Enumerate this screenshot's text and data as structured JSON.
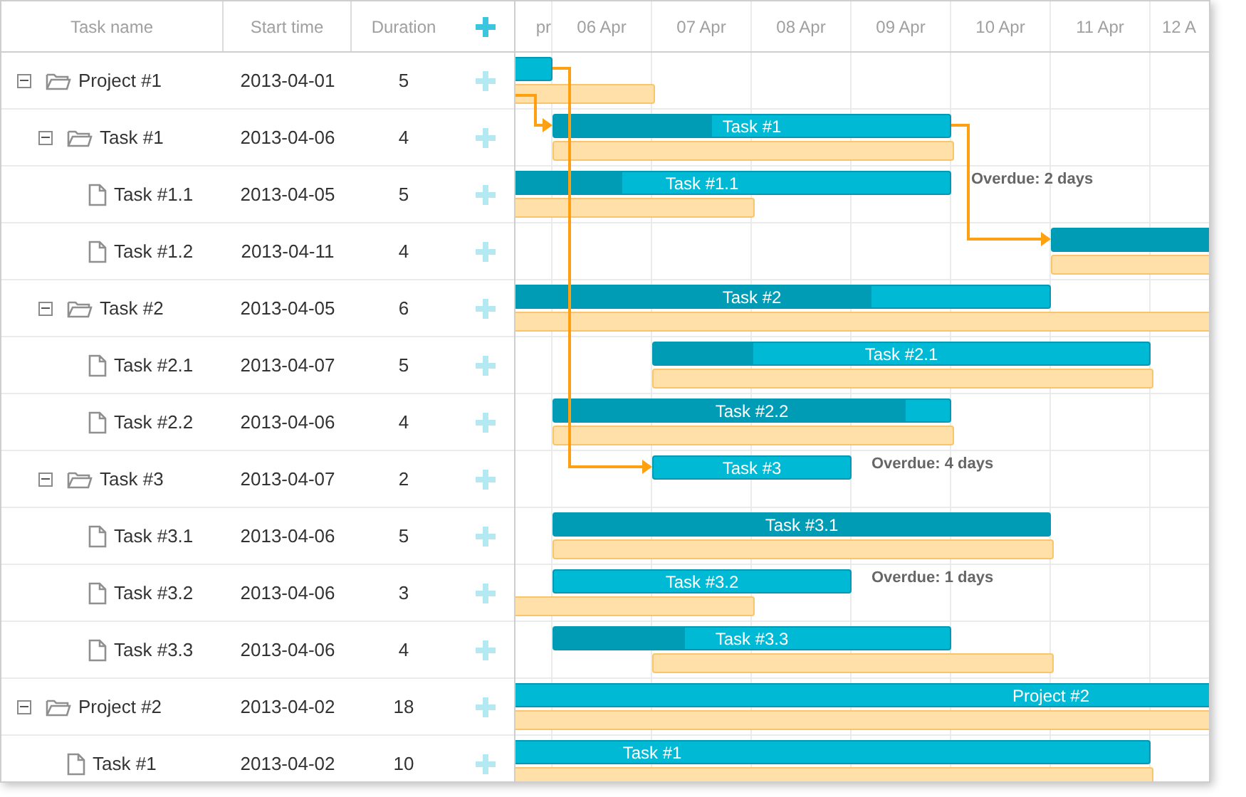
{
  "columns": [
    {
      "label": "Task name"
    },
    {
      "label": "Start time"
    },
    {
      "label": "Duration"
    }
  ],
  "scale": [
    {
      "label": "pr"
    },
    {
      "label": "06 Apr"
    },
    {
      "label": "07 Apr"
    },
    {
      "label": "08 Apr"
    },
    {
      "label": "09 Apr"
    },
    {
      "label": "10 Apr"
    },
    {
      "label": "11 Apr"
    },
    {
      "label": "12 A"
    }
  ],
  "tasks": [
    {
      "name": "Project #1",
      "start": "2013-04-01",
      "duration": "5",
      "expanded": true,
      "children": [
        {
          "name": "Task #1",
          "bar_label": "Task #1",
          "start": "2013-04-06",
          "duration": "4",
          "expanded": true,
          "level": 0.4,
          "children": [
            {
              "name": "Task #1.1",
              "bar_label": "Task #1.1",
              "start": "2013-04-05",
              "duration": "5",
              "level": 0.34,
              "overdue": "Overdue: 2 days"
            },
            {
              "name": "Task #1.2",
              "start": "2013-04-11",
              "duration": "4",
              "level": 0.6
            }
          ]
        },
        {
          "name": "Task #2",
          "bar_label": "Task #2",
          "start": "2013-04-05",
          "duration": "6",
          "expanded": true,
          "level": 0.7,
          "children": [
            {
              "name": "Task #2.1",
              "bar_label": "Task #2.1",
              "start": "2013-04-07",
              "duration": "5",
              "level": 0.2
            },
            {
              "name": "Task #2.2",
              "bar_label": "Task #2.2",
              "start": "2013-04-06",
              "duration": "4",
              "level": 0.89
            }
          ]
        },
        {
          "name": "Task #3",
          "bar_label": "Task #3",
          "start": "2013-04-07",
          "duration": "2",
          "expanded": true,
          "overdue": "Overdue: 4 days",
          "children": [
            {
              "name": "Task #3.1",
              "bar_label": "Task #3.1",
              "start": "2013-04-06",
              "duration": "5",
              "level": 1
            },
            {
              "name": "Task #3.2",
              "bar_label": "Task #3.2",
              "start": "2013-04-06",
              "duration": "3",
              "overdue": "Overdue: 1 days"
            },
            {
              "name": "Task #3.3",
              "bar_label": "Task #3.3",
              "start": "2013-04-06",
              "duration": "4",
              "level": 0.33
            }
          ]
        }
      ]
    },
    {
      "name": "Project #2",
      "bar_label": "Project #2",
      "start": "2013-04-02",
      "duration": "18",
      "expanded": true,
      "children": [
        {
          "name": "Task #1",
          "bar_label": "Task #1",
          "start": "2013-04-02",
          "duration": "10"
        }
      ]
    }
  ]
}
